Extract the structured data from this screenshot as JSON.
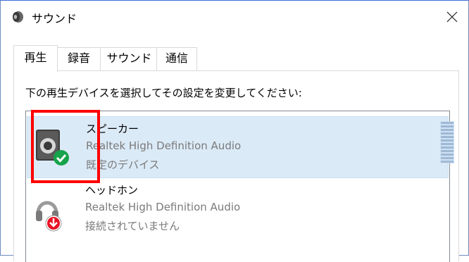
{
  "window": {
    "title": "サウンド",
    "close_symbol": "✕"
  },
  "tabs": [
    {
      "label": "再生",
      "active": true
    },
    {
      "label": "録音",
      "active": false
    },
    {
      "label": "サウンド",
      "active": false
    },
    {
      "label": "通信",
      "active": false
    }
  ],
  "instruction": "下の再生デバイスを選択してその設定を変更してください:",
  "devices": [
    {
      "name": "スピーカー",
      "driver": "Realtek High Definition Audio",
      "status": "既定のデバイス",
      "selected": true,
      "icon": "speaker-icon",
      "badge": "default-check-icon"
    },
    {
      "name": "ヘッドホン",
      "driver": "Realtek High Definition Audio",
      "status": "接続されていません",
      "selected": false,
      "icon": "headphones-icon",
      "badge": "disconnected-arrow-icon"
    }
  ],
  "colors": {
    "accent_check": "#16a34a",
    "badge_disconnected": "#e81123",
    "highlight": "#ff0000",
    "selected_row": "#dbeaf7"
  }
}
